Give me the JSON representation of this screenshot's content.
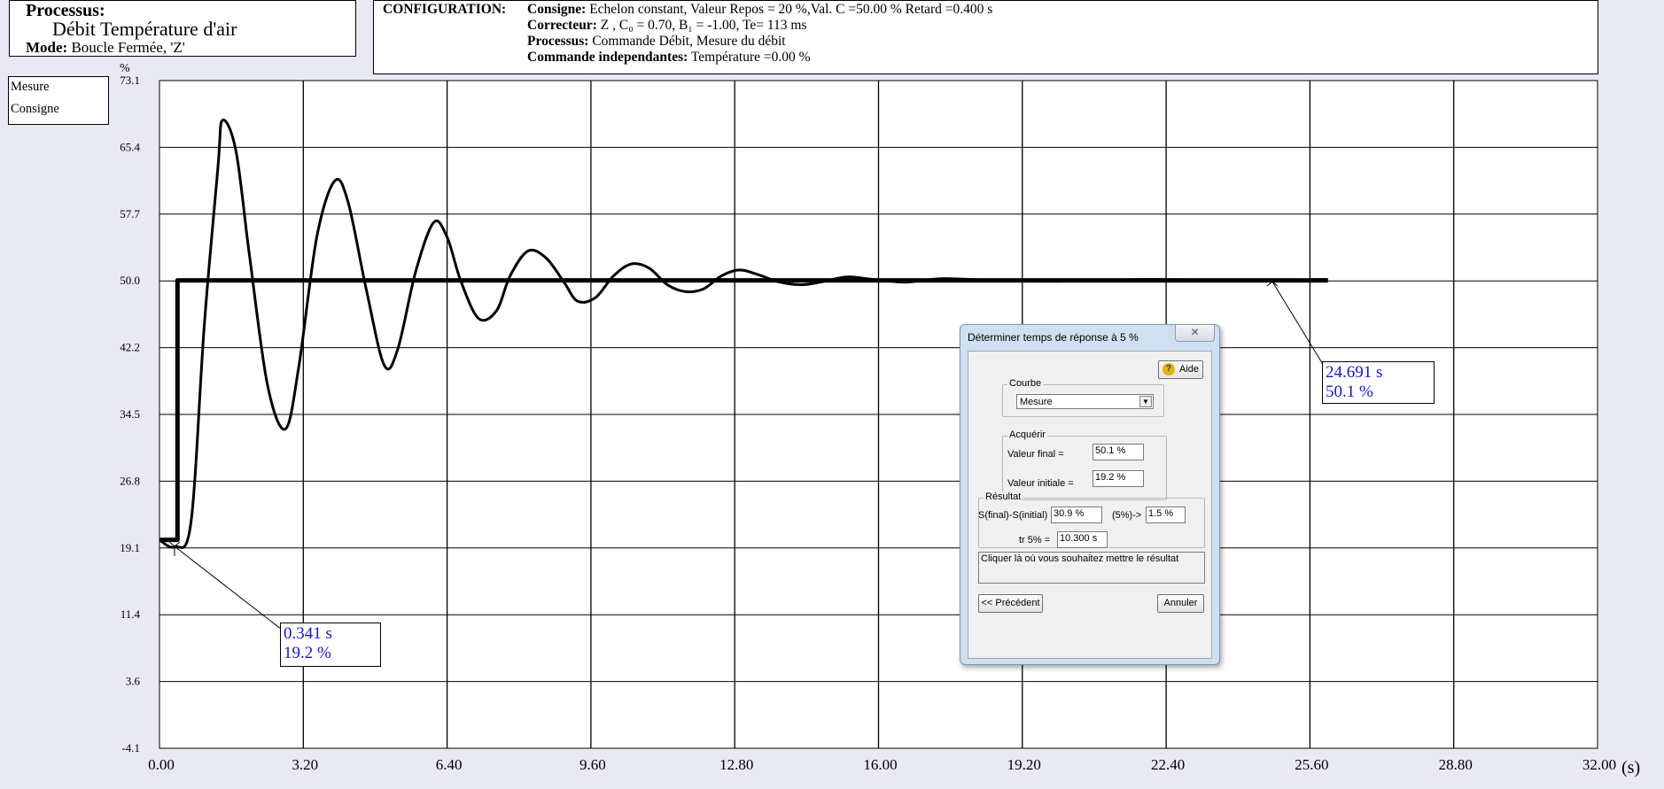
{
  "process_box": {
    "heading": "Processus:",
    "name": "Débit Température d'air",
    "mode_label": "Mode:",
    "mode_value": "Boucle Fermée, 'Z'"
  },
  "config": {
    "title": "CONFIGURATION:",
    "consigne_label": "Consigne:",
    "consigne_value": "Echelon constant, Valeur Repos = 20 %,Val. C =50.00 % Retard =0.400 s",
    "correcteur_label": "Correcteur:",
    "correcteur_value": "Z , C₀ = 0.70, B₁ = -1.00, Te= 113 ms",
    "processus_label": "Processus:",
    "processus_value": "Commande Débit, Mesure du débit",
    "commande_label": "Commande independantes:",
    "commande_value": "Température =0.00 %"
  },
  "legend": {
    "items": [
      "Mesure",
      "Consigne"
    ]
  },
  "annotations": {
    "start": {
      "time": "0.341 s",
      "value": "19.2 %"
    },
    "end": {
      "time": "24.691 s",
      "value": "50.1 %"
    }
  },
  "chart_data": {
    "type": "line",
    "ylabel": "%",
    "xlabel": "(s)",
    "xlim": [
      0,
      32
    ],
    "ylim": [
      -4.1,
      73.1
    ],
    "x_ticks": [
      "0.00",
      "3.20",
      "6.40",
      "9.60",
      "12.80",
      "16.00",
      "19.20",
      "22.40",
      "25.60",
      "28.80",
      "32.00"
    ],
    "y_ticks": [
      "73.1",
      "65.4",
      "57.7",
      "50.0",
      "42.2",
      "34.5",
      "26.8",
      "19.1",
      "11.4",
      "3.6",
      "-4.1"
    ],
    "grid": true,
    "series": [
      {
        "name": "Consigne",
        "x": [
          0.0,
          0.4,
          0.4,
          26.0
        ],
        "y": [
          20.0,
          20.0,
          50.0,
          50.0
        ]
      },
      {
        "name": "Mesure",
        "x": [
          0.0,
          0.34,
          0.7,
          1.0,
          1.3,
          1.4,
          1.7,
          2.0,
          2.4,
          2.8,
          3.1,
          3.5,
          3.9,
          4.2,
          4.6,
          5.0,
          5.3,
          5.7,
          6.1,
          6.4,
          6.7,
          7.1,
          7.5,
          7.8,
          8.2,
          8.6,
          9.0,
          9.3,
          9.7,
          10.1,
          10.5,
          10.9,
          11.3,
          11.7,
          12.1,
          12.5,
          12.9,
          13.3,
          13.8,
          14.3,
          14.8,
          15.3,
          15.9,
          16.6,
          17.4,
          18.5,
          20.0,
          22.0,
          24.0,
          26.0
        ],
        "y": [
          20.0,
          19.2,
          22.0,
          45.0,
          63.0,
          68.5,
          65.0,
          53.0,
          38.0,
          32.8,
          40.0,
          55.0,
          61.5,
          59.0,
          49.0,
          40.2,
          42.0,
          51.0,
          56.7,
          55.0,
          50.0,
          45.6,
          46.5,
          50.5,
          53.4,
          52.6,
          49.8,
          47.6,
          48.0,
          50.5,
          51.9,
          51.4,
          49.5,
          48.7,
          49.0,
          50.5,
          51.2,
          50.7,
          49.8,
          49.5,
          49.9,
          50.4,
          50.1,
          49.8,
          50.2,
          50.0,
          49.9,
          50.1,
          50.0,
          50.1
        ]
      }
    ]
  },
  "dialog": {
    "title": "Déterminer temps de réponse à 5 %",
    "close_label": "✕",
    "help_label": "Aide",
    "help_icon": "?",
    "courbe_group": "Courbe",
    "courbe_value": "Mesure",
    "dropdown_arrow": "▼",
    "acquerir_group": "Acquérir",
    "final_label": "Valeur final =",
    "final_value": "50.1 %",
    "initial_label": "Valeur initiale =",
    "initial_value": "19.2 %",
    "resultat_group": "Résultat",
    "diff_label": "S(final)-S(initial) =",
    "diff_value": "30.9 %",
    "pct_label": "(5%)->",
    "pct_value": "1.5 %",
    "tr_label": "tr 5% =",
    "tr_value": "10.300 s",
    "message": "Cliquer là où vous souhaitez mettre le résultat",
    "prev_label": "<< Précédent",
    "cancel_label": "Annuler"
  }
}
